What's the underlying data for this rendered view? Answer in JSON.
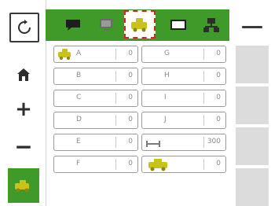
{
  "sidebar": {
    "reset": {
      "label": "",
      "icon": "reset-icon"
    },
    "home": {
      "icon": "home-icon"
    },
    "plus_label": "+",
    "minus_label": "−",
    "active": {
      "label": ""
    },
    "icons": [
      "reset-icon",
      "home-icon",
      "plus-icon",
      "minus-icon",
      "implement-icon"
    ]
  },
  "tabs": [
    {
      "icon": "chat-icon",
      "selected": false
    },
    {
      "icon": "monitor-icon",
      "selected": false
    },
    {
      "icon": "implement-icon",
      "selected": true
    },
    {
      "icon": "screen-icon",
      "selected": false
    },
    {
      "icon": "network-icon",
      "selected": false
    }
  ],
  "topright": {
    "text": ""
  },
  "grid": {
    "rows": [
      {
        "left": {
          "label": "A",
          "value": "0",
          "icon": "implement-icon"
        },
        "right": {
          "label": "G",
          "value": "0"
        }
      },
      {
        "left": {
          "label": "B",
          "value": "0"
        },
        "right": {
          "label": "H",
          "value": "0"
        }
      },
      {
        "left": {
          "label": "C",
          "value": "0"
        },
        "right": {
          "label": "I",
          "value": "0"
        }
      },
      {
        "left": {
          "label": "D",
          "value": "0"
        },
        "right": {
          "label": "J",
          "value": "0"
        }
      },
      {
        "left": {
          "label": "E",
          "value": "0"
        },
        "right": {
          "label": "",
          "value": "300"
        }
      },
      {
        "left": {
          "label": "F",
          "value": "0"
        },
        "right": {
          "label": "",
          "value": "0",
          "icon": "implement-icon"
        }
      }
    ]
  },
  "colors": {
    "accent_green": "#3f9a2a",
    "implement_yellow": "#c9c21a",
    "selection_red": "#e02020",
    "panel_grey": "#dcdcdc"
  }
}
